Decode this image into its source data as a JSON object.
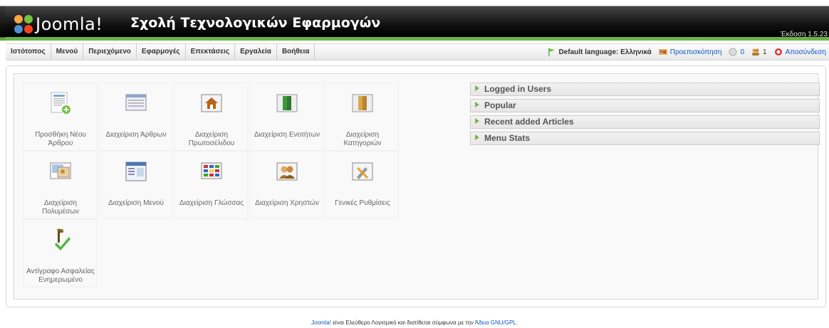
{
  "header": {
    "logo_text": "Joomla!",
    "site_name": "Σχολή Τεχνολογικών Εφαρμογών",
    "version": "Έκδοση 1.5.23"
  },
  "menu": {
    "items": [
      "Ιστότοπος",
      "Μενού",
      "Περιεχόμενο",
      "Εφαρμογές",
      "Επεκτάσεις",
      "Εργαλεία",
      "Βοήθεια"
    ]
  },
  "status": {
    "language": "Default language: Ελληνικά",
    "preview": "Προεπισκόπηση",
    "messages_count": "0",
    "users_count": "1",
    "logout": "Αποσύνδεση"
  },
  "icons": [
    {
      "label": "Προσθήκη Νέου Άρθρου",
      "icon": "add-article-icon"
    },
    {
      "label": "Διαχείριση Άρθρων",
      "icon": "article-manager-icon"
    },
    {
      "label": "Διαχείριση Πρωτοσέλιδου",
      "icon": "frontpage-manager-icon"
    },
    {
      "label": "Διαχείριση Ενοτήτων",
      "icon": "section-manager-icon"
    },
    {
      "label": "Διαχείριση Κατηγοριών",
      "icon": "category-manager-icon"
    },
    {
      "label": "Διαχείριση Πολυμέσων",
      "icon": "media-manager-icon"
    },
    {
      "label": "Διαχείριση Μενού",
      "icon": "menu-manager-icon"
    },
    {
      "label": "Διαχείριση Γλώσσας",
      "icon": "language-manager-icon"
    },
    {
      "label": "Διαχείριση Χρηστών",
      "icon": "user-manager-icon"
    },
    {
      "label": "Γενικές Ρυθμίσεις",
      "icon": "global-config-icon"
    },
    {
      "label": "Αντίγραφο Ασφαλείας Ενημερωμένο",
      "icon": "backup-icon"
    }
  ],
  "panels": [
    "Logged in Users",
    "Popular",
    "Recent added Articles",
    "Menu Stats"
  ],
  "footer": {
    "link": "Joomla!",
    "text": " είναι Ελεύθερο Λογισμικό και διατίθεται σύμφωνα με την ",
    "license": "Άδεια GNU/GPL",
    "end": "."
  }
}
